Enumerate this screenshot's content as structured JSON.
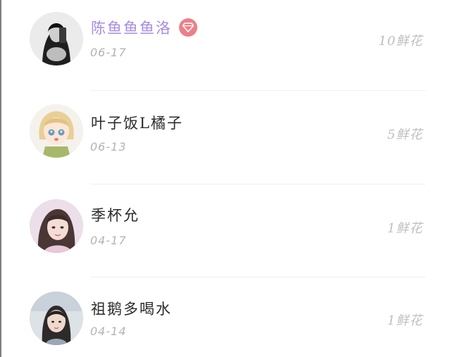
{
  "items": [
    {
      "name": "陈鱼鱼鱼洛",
      "date": "06-17",
      "flowers": "10鲜花",
      "vip": true
    },
    {
      "name": "叶子饭L橘子",
      "date": "06-13",
      "flowers": "5鲜花",
      "vip": false
    },
    {
      "name": "季杯允",
      "date": "04-17",
      "flowers": "1鲜花",
      "vip": false
    },
    {
      "name": "祖鹅多喝水",
      "date": "04-14",
      "flowers": "1鲜花",
      "vip": false
    }
  ],
  "colors": {
    "vip_name": "#a98be6",
    "vip_badge": "#ee7f86",
    "secondary_text": "#b3b3b3"
  },
  "icons": {
    "vip_badge": "diamond-icon"
  }
}
